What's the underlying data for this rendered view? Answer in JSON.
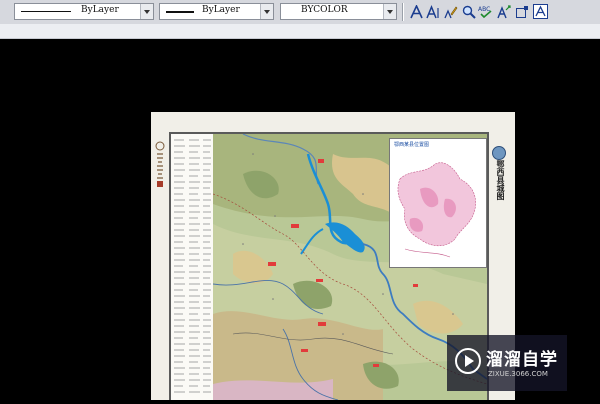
{
  "toolbar": {
    "linetype": {
      "value": "ByLayer"
    },
    "lineweight": {
      "value": "ByLayer"
    },
    "color": {
      "value": "BYCOLOR"
    },
    "text_tools": [
      "multiline-text",
      "single-line-text",
      "edit-text",
      "find-text",
      "spell-check",
      "scale-text",
      "justify-text",
      "text-frame"
    ]
  },
  "drawing": {
    "inset_title": "鄂西某县位置图",
    "side_title": "鄂西县城图"
  },
  "watermark": {
    "title": "溜溜自学",
    "url": "ZIXUE.3066.COM"
  },
  "colors": {
    "canvas": "#000000",
    "toolbar": "#d6d8de",
    "water": "#1a8fd6",
    "watermark_bg": "#14142a"
  }
}
